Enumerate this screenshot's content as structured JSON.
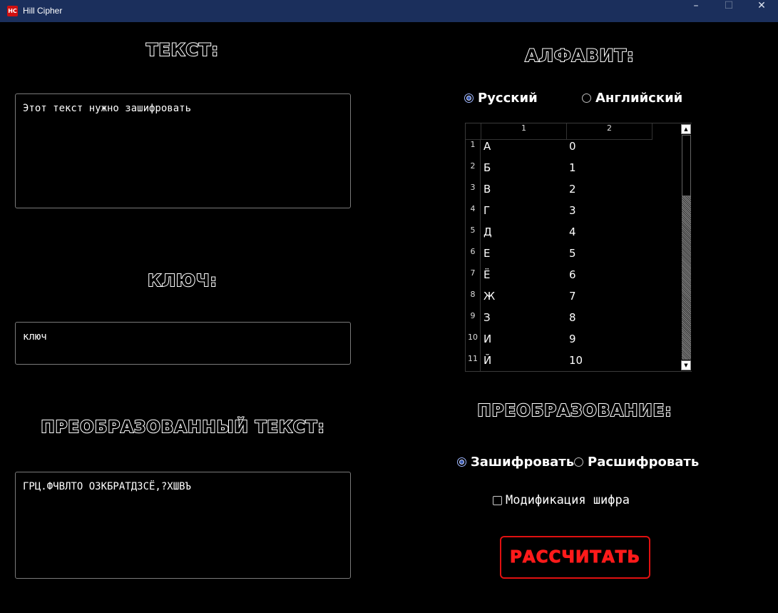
{
  "window": {
    "title": "Hill Cipher",
    "icon_text": "HC",
    "minimize": "–",
    "maximize": "☐",
    "close": "✕"
  },
  "left": {
    "text_heading": "ТЕКСТ:",
    "text_value": "Этот текст нужно зашифровать",
    "key_heading": "КЛЮЧ:",
    "key_value": "ключ",
    "result_heading": "ПРЕОБРАЗОВАННЫЙ ТЕКСТ:",
    "result_value": "ГРЦ.ФЧВЛТО ОЗКБРАТДЗСЁ,?ХШВЪ"
  },
  "alphabet": {
    "heading": "АЛФАВИТ:",
    "options": [
      {
        "label": "Русский",
        "checked": true
      },
      {
        "label": "Английский",
        "checked": false
      }
    ],
    "columns": [
      "1",
      "2"
    ],
    "rows": [
      {
        "n": "1",
        "letter": "А",
        "code": "0"
      },
      {
        "n": "2",
        "letter": "Б",
        "code": "1"
      },
      {
        "n": "3",
        "letter": "В",
        "code": "2"
      },
      {
        "n": "4",
        "letter": "Г",
        "code": "3"
      },
      {
        "n": "5",
        "letter": "Д",
        "code": "4"
      },
      {
        "n": "6",
        "letter": "Е",
        "code": "5"
      },
      {
        "n": "7",
        "letter": "Ё",
        "code": "6"
      },
      {
        "n": "8",
        "letter": "Ж",
        "code": "7"
      },
      {
        "n": "9",
        "letter": "З",
        "code": "8"
      },
      {
        "n": "10",
        "letter": "И",
        "code": "9"
      },
      {
        "n": "11",
        "letter": "Й",
        "code": "10"
      }
    ],
    "scroll_up": "▲",
    "scroll_down": "▼"
  },
  "transform": {
    "heading": "ПРЕОБРАЗОВАНИЕ:",
    "options": [
      {
        "label": "Зашифровать",
        "checked": true
      },
      {
        "label": "Расшифровать",
        "checked": false
      }
    ],
    "modification_label": "Модификация шифра",
    "modification_checked": false,
    "calculate_label": "РАССЧИТАТЬ"
  },
  "colors": {
    "titlebar": "#1b2f5c",
    "background": "#000000",
    "accent_red": "#e01010"
  }
}
